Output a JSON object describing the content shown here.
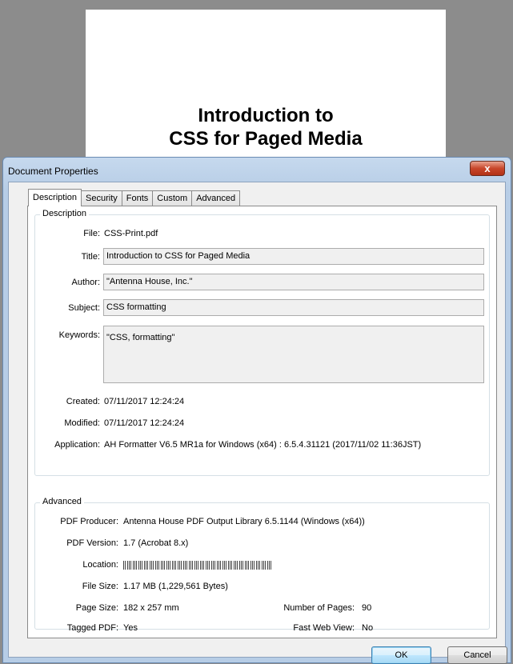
{
  "document": {
    "title_line1": "Introduction to",
    "title_line2": "CSS for Paged Media"
  },
  "dialog": {
    "title": "Document Properties",
    "close_glyph": "x",
    "tabs": [
      "Description",
      "Security",
      "Fonts",
      "Custom",
      "Advanced"
    ],
    "active_tab": "Description"
  },
  "description": {
    "group_label": "Description",
    "file_label": "File:",
    "file_value": "CSS-Print.pdf",
    "title_label": "Title:",
    "title_value": "Introduction to CSS for Paged Media",
    "author_label": "Author:",
    "author_value": "\"Antenna House, Inc.\"",
    "subject_label": "Subject:",
    "subject_value": "CSS formatting",
    "keywords_label": "Keywords:",
    "keywords_value": "\"CSS, formatting\"",
    "created_label": "Created:",
    "created_value": "07/11/2017 12:24:24",
    "modified_label": "Modified:",
    "modified_value": "07/11/2017 12:24:24",
    "application_label": "Application:",
    "application_value": "AH Formatter V6.5 MR1a for Windows (x64) : 6.5.4.31121 (2017/11/02 11:36JST)"
  },
  "advanced": {
    "group_label": "Advanced",
    "pdf_producer_label": "PDF Producer:",
    "pdf_producer_value": "Antenna House PDF Output Library 6.5.1144 (Windows (x64))",
    "pdf_version_label": "PDF Version:",
    "pdf_version_value": "1.7 (Acrobat 8.x)",
    "location_label": "Location:",
    "file_size_label": "File Size:",
    "file_size_value": "1.17 MB (1,229,561 Bytes)",
    "page_size_label": "Page Size:",
    "page_size_value": "182 x 257 mm",
    "num_pages_label": "Number of Pages:",
    "num_pages_value": "90",
    "tagged_pdf_label": "Tagged PDF:",
    "tagged_pdf_value": "Yes",
    "fast_web_view_label": "Fast Web View:",
    "fast_web_view_value": "No"
  },
  "buttons": {
    "ok": "OK",
    "cancel": "Cancel"
  }
}
